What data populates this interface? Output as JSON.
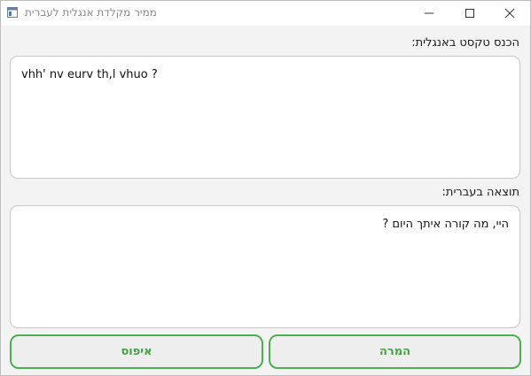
{
  "window": {
    "title": "ממיר מקלדת אנגלית לעברית",
    "icon": "app-window-icon",
    "controls": [
      "minimize-icon",
      "maximize-icon",
      "close-icon"
    ]
  },
  "input_section": {
    "label": "הכנס טקסט באנגלית:",
    "value": "vhh' nv eurv th,l vhuo ?"
  },
  "output_section": {
    "label": "תוצאה בעברית:",
    "value": "היי, מה קורה איתך היום ?"
  },
  "buttons": {
    "reset_label": "איפוס",
    "convert_label": "המרה"
  },
  "colors": {
    "accent": "#4caf50",
    "accent_text": "#43a047"
  }
}
